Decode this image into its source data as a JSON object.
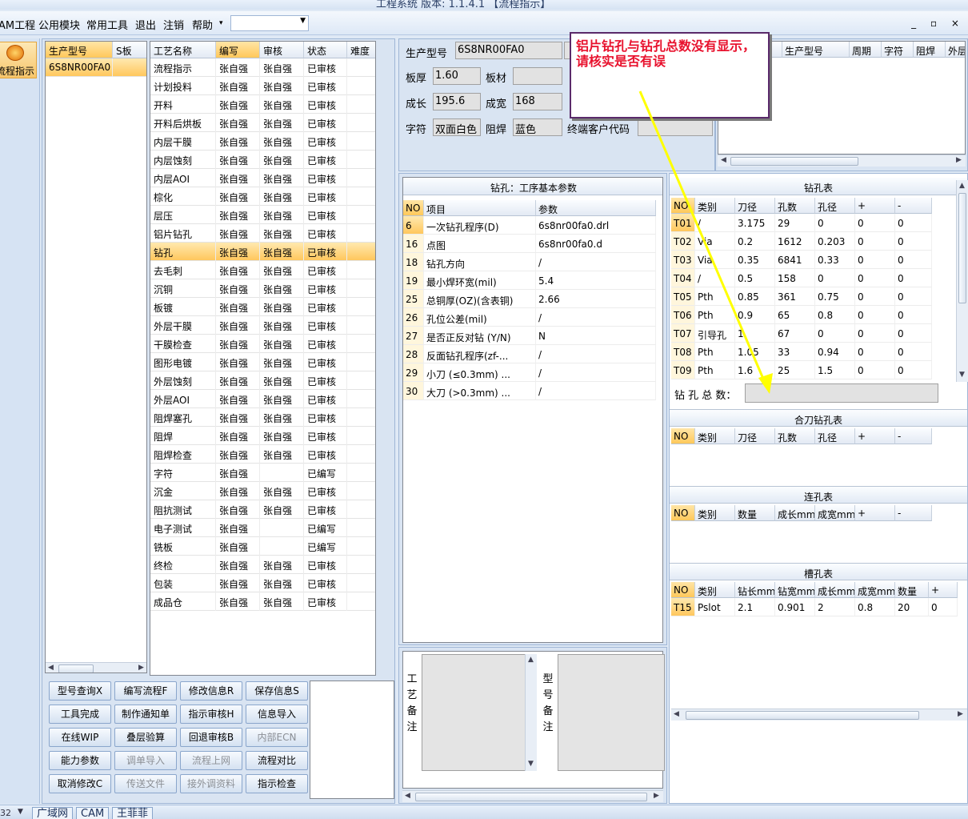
{
  "title_bar": {
    "text": "工程系统 版本: 1.1.4.1 【流程指示】"
  },
  "menu": {
    "items": [
      "AM工程",
      "公用模块",
      "常用工具",
      "退出",
      "注销",
      "帮助"
    ],
    "combo_value": "",
    "window_controls": "_ ▫ ×"
  },
  "nav": {
    "label": "流程指示"
  },
  "model_list": {
    "headers": [
      "生产型号",
      "S板"
    ],
    "rows": [
      [
        "6S8NR00FA0",
        ""
      ]
    ]
  },
  "process_grid": {
    "headers": [
      "工艺名称",
      "编写",
      "审核",
      "状态",
      "难度"
    ],
    "selected_index": 10,
    "rows": [
      [
        "流程指示",
        "张自强",
        "张自强",
        "已审核",
        ""
      ],
      [
        "计划投料",
        "张自强",
        "张自强",
        "已审核",
        ""
      ],
      [
        "开料",
        "张自强",
        "张自强",
        "已审核",
        ""
      ],
      [
        "开料后烘板",
        "张自强",
        "张自强",
        "已审核",
        ""
      ],
      [
        "内层干膜",
        "张自强",
        "张自强",
        "已审核",
        ""
      ],
      [
        "内层蚀刻",
        "张自强",
        "张自强",
        "已审核",
        ""
      ],
      [
        "内层AOI",
        "张自强",
        "张自强",
        "已审核",
        ""
      ],
      [
        "棕化",
        "张自强",
        "张自强",
        "已审核",
        ""
      ],
      [
        "层压",
        "张自强",
        "张自强",
        "已审核",
        ""
      ],
      [
        "铝片钻孔",
        "张自强",
        "张自强",
        "已审核",
        ""
      ],
      [
        "钻孔",
        "张自强",
        "张自强",
        "已审核",
        ""
      ],
      [
        "去毛刺",
        "张自强",
        "张自强",
        "已审核",
        ""
      ],
      [
        "沉铜",
        "张自强",
        "张自强",
        "已审核",
        ""
      ],
      [
        "板镀",
        "张自强",
        "张自强",
        "已审核",
        ""
      ],
      [
        "外层干膜",
        "张自强",
        "张自强",
        "已审核",
        ""
      ],
      [
        "干膜检查",
        "张自强",
        "张自强",
        "已审核",
        ""
      ],
      [
        "图形电镀",
        "张自强",
        "张自强",
        "已审核",
        ""
      ],
      [
        "外层蚀刻",
        "张自强",
        "张自强",
        "已审核",
        ""
      ],
      [
        "外层AOI",
        "张自强",
        "张自强",
        "已审核",
        ""
      ],
      [
        "阻焊塞孔",
        "张自强",
        "张自强",
        "已审核",
        ""
      ],
      [
        "阻焊",
        "张自强",
        "张自强",
        "已审核",
        ""
      ],
      [
        "阻焊检查",
        "张自强",
        "张自强",
        "已审核",
        ""
      ],
      [
        "字符",
        "张自强",
        "",
        "已编写",
        ""
      ],
      [
        "沉金",
        "张自强",
        "张自强",
        "已审核",
        ""
      ],
      [
        "阻抗测试",
        "张自强",
        "张自强",
        "已审核",
        ""
      ],
      [
        "电子测试",
        "张自强",
        "",
        "已编写",
        ""
      ],
      [
        "铣板",
        "张自强",
        "",
        "已编写",
        ""
      ],
      [
        "终检",
        "张自强",
        "张自强",
        "已审核",
        ""
      ],
      [
        "包装",
        "张自强",
        "张自强",
        "已审核",
        ""
      ],
      [
        "成品仓",
        "张自强",
        "张自强",
        "已审核",
        ""
      ]
    ]
  },
  "buttons": [
    [
      {
        "label": "型号查询X",
        "enabled": true
      },
      {
        "label": "编写流程F",
        "enabled": true
      },
      {
        "label": "修改信息R",
        "enabled": true
      },
      {
        "label": "保存信息S",
        "enabled": true
      }
    ],
    [
      {
        "label": "工具完成",
        "enabled": true
      },
      {
        "label": "制作通知单",
        "enabled": true
      },
      {
        "label": "指示审核H",
        "enabled": true
      },
      {
        "label": "信息导入",
        "enabled": true
      }
    ],
    [
      {
        "label": "在线WIP",
        "enabled": true
      },
      {
        "label": "叠层验算",
        "enabled": true
      },
      {
        "label": "回退审核B",
        "enabled": true
      },
      {
        "label": "内部ECN",
        "enabled": false
      }
    ],
    [
      {
        "label": "能力参数",
        "enabled": true
      },
      {
        "label": "调单导入",
        "enabled": false
      },
      {
        "label": "流程上网",
        "enabled": false
      },
      {
        "label": "流程对比",
        "enabled": true
      }
    ],
    [
      {
        "label": "取消修改C",
        "enabled": true
      },
      {
        "label": "传送文件",
        "enabled": false
      },
      {
        "label": "接外调资料",
        "enabled": false
      },
      {
        "label": "指示检查",
        "enabled": true
      }
    ]
  ],
  "info": {
    "model_label": "生产型号",
    "model_value": "6S8NR00FA0",
    "thickness_label": "板厚",
    "thickness_value": "1.60",
    "material_label": "板材",
    "material_value": "",
    "length_label": "成长",
    "length_value": "195.6",
    "width_label": "成宽",
    "width_value": "168",
    "char_label": "字符",
    "char_value": "双面白色",
    "mask_label": "阻焊",
    "mask_value": "蓝色",
    "customer_label": "终端客户代码",
    "customer_value": ""
  },
  "top_right": {
    "headers": [
      "生产型号",
      "周期",
      "字符",
      "阻焊",
      "外层"
    ]
  },
  "drill_params": {
    "title": "钻孔：工序基本参数",
    "headers": [
      "NO",
      "项目",
      "参数"
    ],
    "rows": [
      [
        "6",
        "一次钻孔程序(D)",
        "6s8nr00fa0.drl"
      ],
      [
        "16",
        "点图",
        "6s8nr00fa0.d"
      ],
      [
        "18",
        "钻孔方向",
        "/"
      ],
      [
        "19",
        "最小焊环宽(mil)",
        "5.4"
      ],
      [
        "25",
        "总铜厚(OZ)(含表铜)",
        "2.66"
      ],
      [
        "26",
        "孔位公差(mil)",
        "/"
      ],
      [
        "27",
        "是否正反对钻 (Y/N)",
        "N"
      ],
      [
        "28",
        "反面钻孔程序(zf-...",
        "/"
      ],
      [
        "29",
        "小刀 (≤0.3mm) ...",
        "/"
      ],
      [
        "30",
        "大刀 (>0.3mm) ...",
        "/"
      ]
    ]
  },
  "remarks": {
    "process_label": "工艺备注",
    "model_label": "型号备注"
  },
  "drill_table": {
    "title": "钻孔表",
    "headers": [
      "NO",
      "类别",
      "刀径",
      "孔数",
      "孔径",
      "+",
      "-"
    ],
    "rows": [
      [
        "T01",
        "/",
        "3.175",
        "29",
        "0",
        "0",
        "0"
      ],
      [
        "T02",
        "Via",
        "0.2",
        "1612",
        "0.203",
        "0",
        "0"
      ],
      [
        "T03",
        "Via",
        "0.35",
        "6841",
        "0.33",
        "0",
        "0"
      ],
      [
        "T04",
        "/",
        "0.5",
        "158",
        "0",
        "0",
        "0"
      ],
      [
        "T05",
        "Pth",
        "0.85",
        "361",
        "0.75",
        "0",
        "0"
      ],
      [
        "T06",
        "Pth",
        "0.9",
        "65",
        "0.8",
        "0",
        "0"
      ],
      [
        "T07",
        "引导孔",
        "1",
        "67",
        "0",
        "0",
        "0"
      ],
      [
        "T08",
        "Pth",
        "1.05",
        "33",
        "0.94",
        "0",
        "0"
      ],
      [
        "T09",
        "Pth",
        "1.6",
        "25",
        "1.5",
        "0",
        "0"
      ]
    ],
    "total_label": "钻 孔 总 数：",
    "total_value": ""
  },
  "combined_table": {
    "title": "合刀钻孔表",
    "headers": [
      "NO",
      "类别",
      "刀径",
      "孔数",
      "孔径",
      "+",
      "-"
    ]
  },
  "link_table": {
    "title": "连孔表",
    "headers": [
      "NO",
      "类别",
      "数量",
      "成长mm",
      "成宽mm",
      "+",
      "-"
    ]
  },
  "slot_table": {
    "title": "槽孔表",
    "headers": [
      "NO",
      "类别",
      "钻长mm",
      "钻宽mm",
      "成长mm",
      "成宽mm",
      "数量",
      "+"
    ],
    "rows": [
      [
        "T15",
        "Pslot",
        "2.1",
        "0.901",
        "2",
        "0.8",
        "20",
        "0"
      ]
    ]
  },
  "status_tabs": [
    "广域网",
    "CAM",
    "王菲菲"
  ],
  "status_left": "32",
  "annotation": {
    "text": "铝片钻孔与钻孔总数没有显示，请核实是否有误"
  },
  "colors": {
    "selected_row": "#ffc75d",
    "annotation_text": "#e8112d",
    "arrow": "#ffff00"
  }
}
